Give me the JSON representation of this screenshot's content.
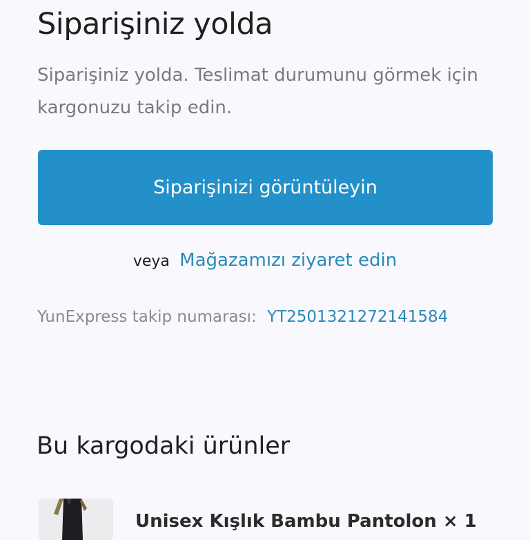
{
  "header": {
    "title": "Siparişiniz yolda",
    "description": "Siparişiniz yolda. Teslimat durumunu görmek için kargonuzu takip edin."
  },
  "actions": {
    "view_order_label": "Siparişinizi görüntüleyin",
    "or_text": "veya",
    "visit_store_label": "Mağazamızı ziyaret edin"
  },
  "tracking": {
    "label": "YunExpress takip numarası:",
    "number": "YT2501321272141584"
  },
  "shipment": {
    "section_title": "Bu kargodaki ürünler",
    "items": [
      {
        "name": "Unisex Kışlık Bambu Pantolon × 1"
      }
    ]
  },
  "colors": {
    "primary": "#2390c9",
    "link": "#2a8ab8",
    "background": "#f8f8fd"
  }
}
